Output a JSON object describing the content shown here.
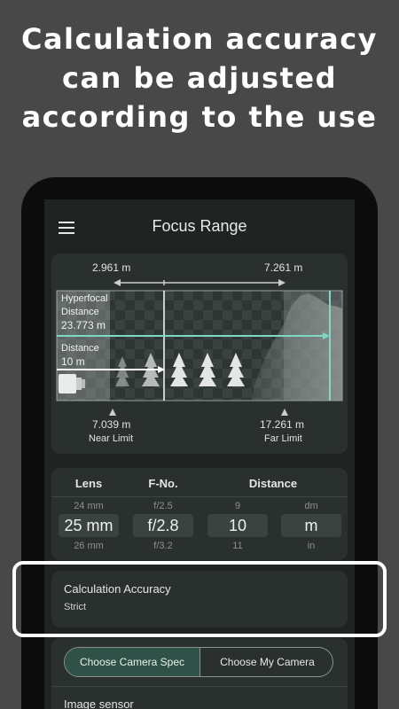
{
  "headline": [
    "Calculation accuracy",
    "can be adjusted",
    "according to the use"
  ],
  "app": {
    "title": "Focus Range"
  },
  "diagram": {
    "near_distance": "2.961 m",
    "far_distance": "7.261 m",
    "hyperfocal_label_1": "Hyperfocal",
    "hyperfocal_label_2": "Distance",
    "hyperfocal_value": "23.773 m",
    "distance_label": "Distance",
    "distance_value": "10 m",
    "near_limit_value": "7.039 m",
    "near_limit_label": "Near Limit",
    "far_limit_value": "17.261 m",
    "far_limit_label": "Far Limit",
    "accent_color": "#7dd9c6"
  },
  "params": {
    "headers": {
      "lens": "Lens",
      "fno": "F-No.",
      "distance": "Distance"
    },
    "lens": {
      "prev": "24 mm",
      "current": "25 mm",
      "next": "26 mm"
    },
    "fno": {
      "prev": "f/2.5",
      "current": "f/2.8",
      "next": "f/3.2"
    },
    "distance": {
      "prev": "9",
      "current": "10",
      "next": "11"
    },
    "unit": {
      "prev": "dm",
      "current": "m",
      "next": "in"
    }
  },
  "accuracy": {
    "label": "Calculation Accuracy",
    "value": "Strict"
  },
  "camera": {
    "choose_spec": "Choose Camera Spec",
    "choose_my": "Choose My Camera",
    "image_sensor": "Image sensor"
  }
}
